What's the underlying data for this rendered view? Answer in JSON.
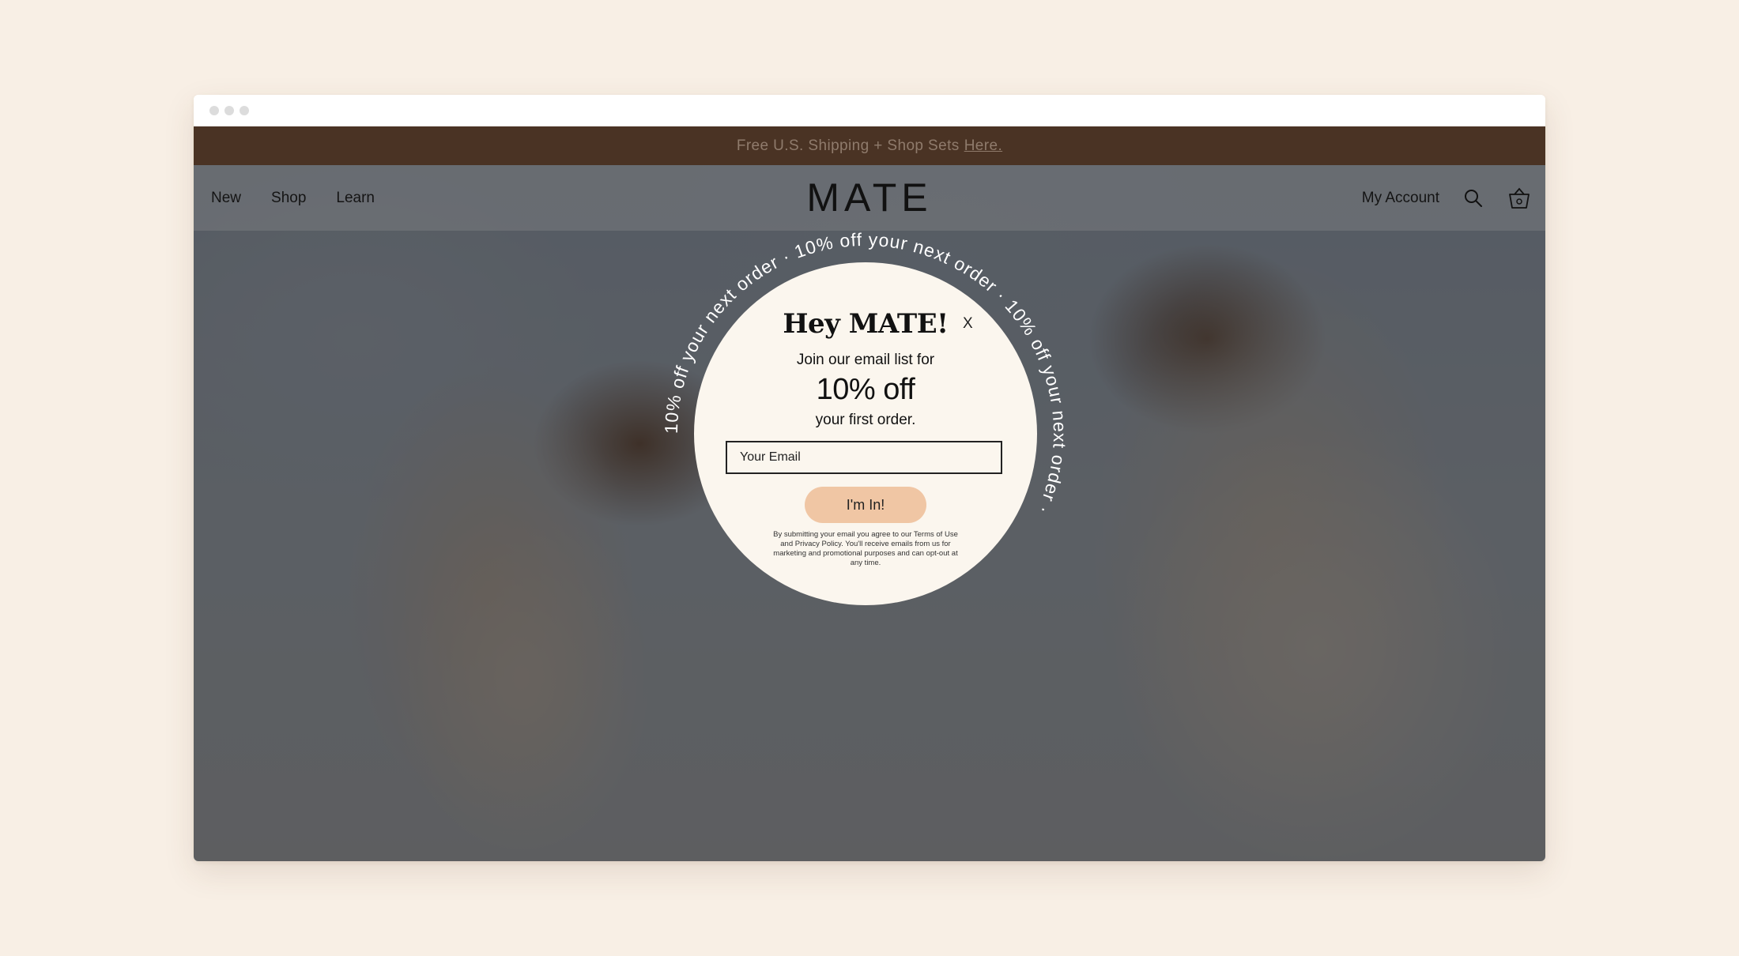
{
  "promo_bar": {
    "text": "Free U.S. Shipping + Shop Sets",
    "link": "Here."
  },
  "nav": {
    "left_items": [
      "New",
      "Shop",
      "Learn"
    ],
    "logo": "MATE",
    "account": "My Account",
    "icons": [
      "search-icon",
      "cart-icon"
    ]
  },
  "popup": {
    "ring_text": "10% off your next order · 10% off your next order · 10% off your next order · ",
    "title": "Hey MATE!",
    "line1": "Join our email list for",
    "discount": "10% off",
    "line2": "your first order.",
    "email_placeholder": "Your Email",
    "button": "I'm In!",
    "legal": "By submitting your email you agree to our Terms of Use and Privacy Policy. You'll receive emails from us for marketing and promotional purposes and can opt-out at any time.",
    "close": "X"
  },
  "colors": {
    "page_bg": "#f8efe5",
    "promo_bg": "#4a3324",
    "popup_bg": "#fbf6ee",
    "button_bg": "#f0c6a4"
  }
}
